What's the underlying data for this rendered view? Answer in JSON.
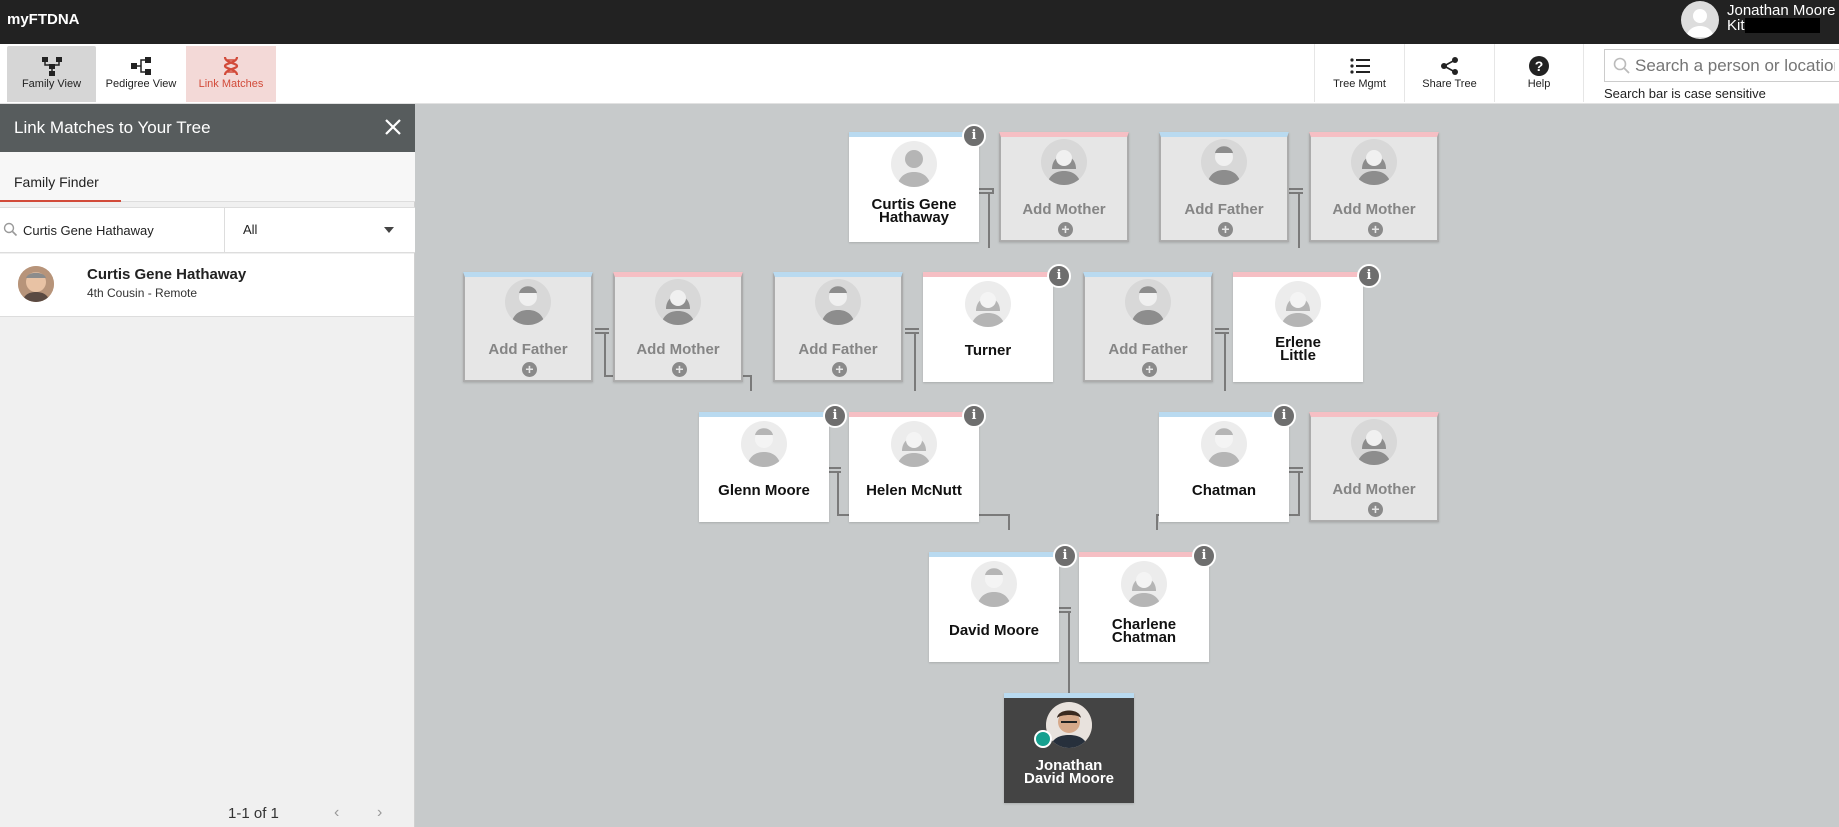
{
  "app": {
    "name": "myFTDNA"
  },
  "user": {
    "name": "Jonathan Moore",
    "kit_label": "Kit"
  },
  "toolbar": {
    "family_view": "Family View",
    "pedigree_view": "Pedigree View",
    "link_matches": "Link Matches",
    "tree_mgmt": "Tree Mgmt",
    "share_tree": "Share Tree",
    "help": "Help"
  },
  "search": {
    "placeholder": "Search a person or location",
    "hint": "Search bar is case sensitive"
  },
  "panel": {
    "title": "Link Matches to Your Tree",
    "tab": "Family Finder",
    "search_value": "Curtis Gene Hathaway",
    "filter_value": "All",
    "matches": [
      {
        "name": "Curtis Gene Hathaway",
        "relationship": "4th Cousin - Remote"
      }
    ],
    "pager": "1-1 of 1"
  },
  "tree": {
    "row0": [
      "Curtis Gene Hathaway",
      "Add Mother",
      "Add Father",
      "Add Mother"
    ],
    "row1": [
      "Add Father",
      "Add Mother",
      "Add Father",
      "Turner",
      "Add Father",
      "Erlene Little"
    ],
    "row2": [
      "Glenn Moore",
      "Helen McNutt",
      "Chatman",
      "Add Mother"
    ],
    "row3": [
      "David Moore",
      "Charlene Chatman"
    ],
    "self": "Jonathan David Moore",
    "info_glyph": "i",
    "plus_glyph": "+"
  },
  "colors": {
    "male_stripe": "#b9daf0",
    "female_stripe": "#f6bfc4",
    "accent": "#d24b3a",
    "self_bg": "#444444",
    "online_dot": "#15a08f"
  }
}
